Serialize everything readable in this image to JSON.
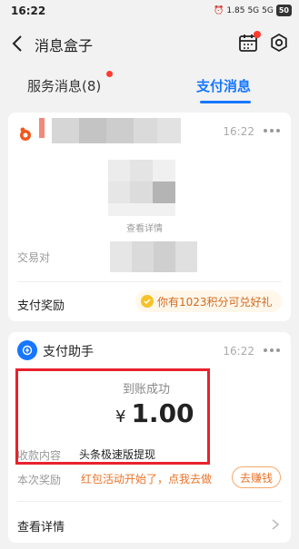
{
  "status_bar": {
    "time": "16:22",
    "battery": "50",
    "net_speed": "1.85",
    "signal_1": "5G",
    "signal_2": "5G"
  },
  "nav": {
    "title": "消息盒子"
  },
  "tabs": {
    "service": "服务消息(8)",
    "payment": "支付消息"
  },
  "card1": {
    "time": "16:22",
    "view_detail": "查看详情",
    "trade_label": "交易对",
    "reward_label": "支付奖励",
    "points_text": "你有1023积分可兑好礼"
  },
  "card2": {
    "title": "支付助手",
    "time": "16:22",
    "status": "到账成功",
    "currency": "¥",
    "amount": "1.00",
    "collect_label": "收款内容",
    "collect_value": "头条极速版提现",
    "bonus_label": "本次奖励",
    "bonus_value": "红包活动开始了，点我去做",
    "earn_button": "去赚钱",
    "detail_link": "查看详情"
  },
  "colors": {
    "accent": "#1677ff",
    "badge": "#ff3b30",
    "highlight": "#e8222d",
    "reward": "#e8742a"
  }
}
